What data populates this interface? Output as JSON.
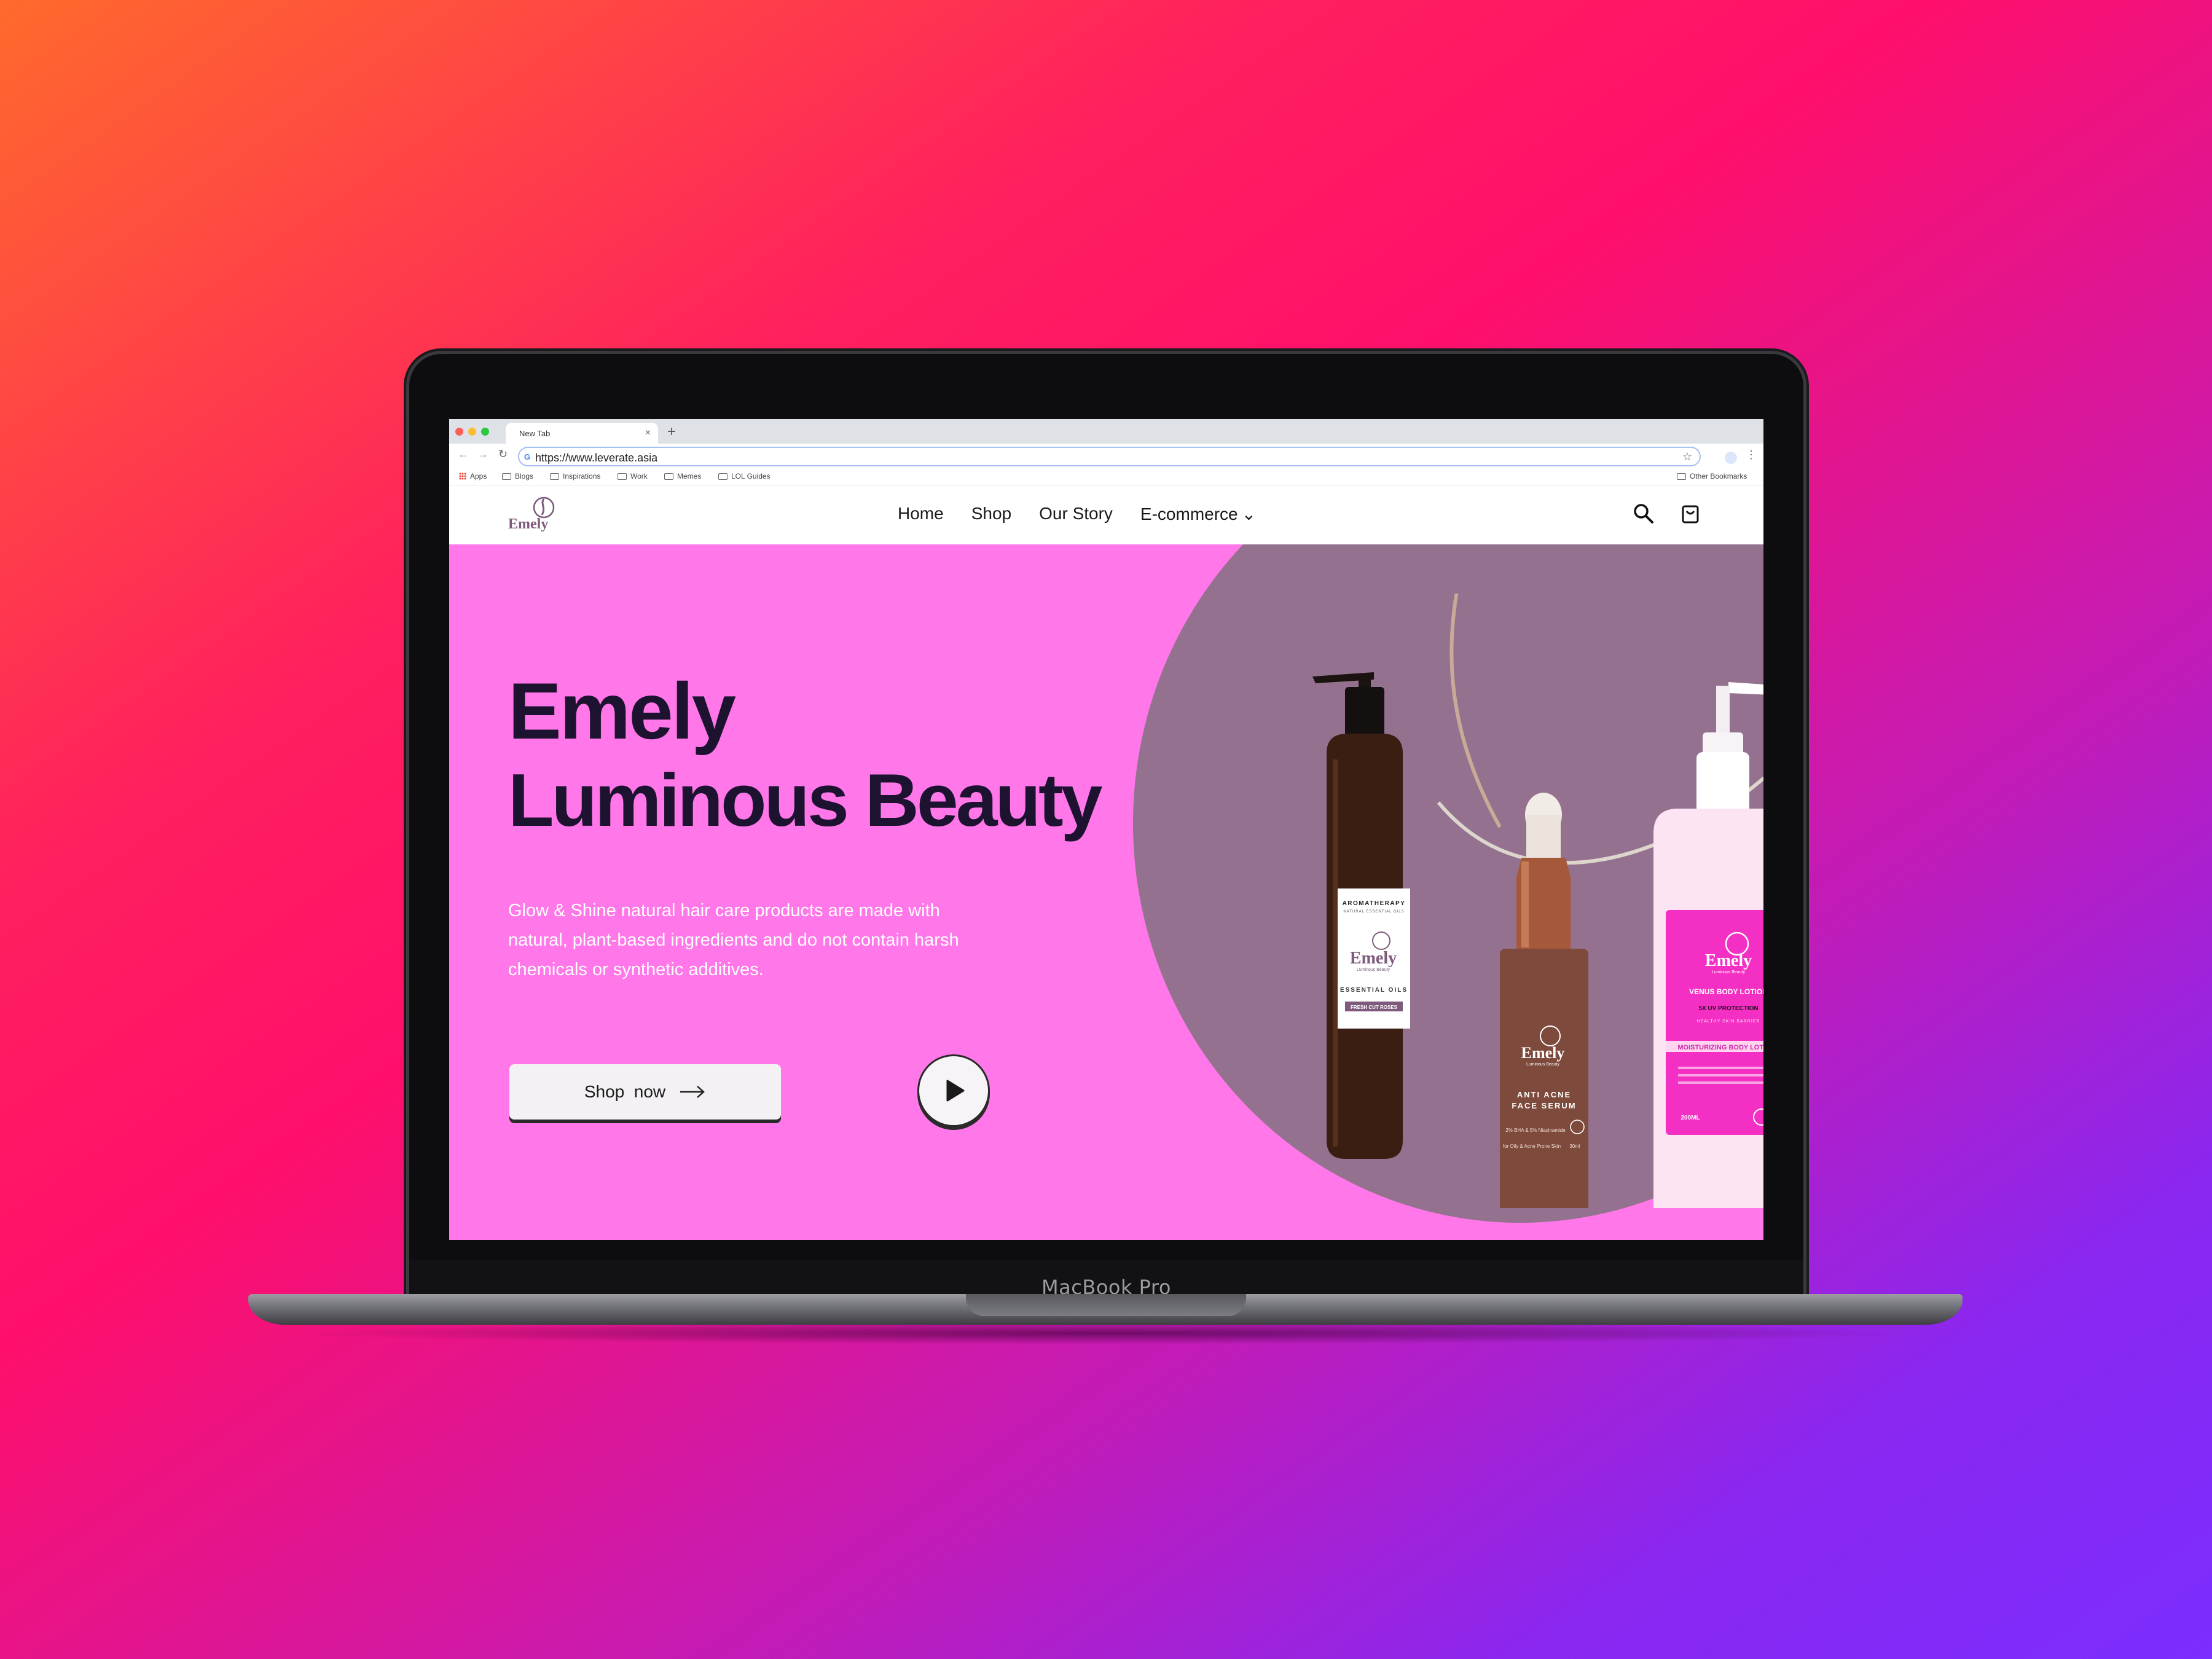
{
  "device": {
    "label": "MacBook Pro"
  },
  "browser": {
    "tab_title": "New Tab",
    "tab_close": "×",
    "new_tab": "+",
    "url": "https://www.leverate.asia",
    "bookmarks": [
      {
        "label": "Apps",
        "icon": "apps-grid-icon"
      },
      {
        "label": "Blogs",
        "icon": "folder-icon"
      },
      {
        "label": "Inspirations",
        "icon": "folder-icon"
      },
      {
        "label": "Work",
        "icon": "folder-icon"
      },
      {
        "label": "Memes",
        "icon": "folder-icon"
      },
      {
        "label": "LOL Guides",
        "icon": "folder-icon"
      }
    ],
    "other_bookmarks": "Other Bookmarks"
  },
  "site": {
    "logo_text": "Emely",
    "nav": [
      {
        "label": "Home"
      },
      {
        "label": "Shop"
      },
      {
        "label": "Our Story"
      },
      {
        "label": "E-commerce",
        "has_dropdown": true
      }
    ],
    "icons": [
      "search-icon",
      "shopping-bag-icon"
    ]
  },
  "hero": {
    "title_line1": "Emely",
    "title_line2": "Luminous Beauty",
    "description": "Glow & Shine natural hair care products are made with natural, plant-based ingredients and do not contain harsh chemicals or synthetic additives.",
    "cta_label": "Shop  now",
    "play_icon": "play-icon",
    "bg_color": "#ff77e8",
    "circle_color": "#93718f"
  },
  "products": {
    "oil": {
      "top": "AROMATHERAPY",
      "sub": "NATURAL ESSENTIAL OILS",
      "brand": "Emely",
      "brand_sub": "Luminous Beauty",
      "name": "ESSENTIAL OILS",
      "variant": "FRESH CUT ROSES"
    },
    "serum": {
      "brand": "Emely",
      "brand_sub": "Luminous Beauty",
      "name1": "ANTI ACNE",
      "name2": "FACE SERUM",
      "detail1": "2% BHA  &  5% Niacinamide",
      "detail2": "for Oily & Acne Prone Skin",
      "volume": "30ml"
    },
    "lotion": {
      "brand": "Emely",
      "brand_sub": "Luminous Beauty",
      "name": "VENUS BODY LOTION",
      "feature": "5X UV PROTECTION",
      "sub": "HEALTHY SKIN BARRIER",
      "band": "MOISTURIZING BODY LOTION",
      "volume": "200ML"
    }
  }
}
